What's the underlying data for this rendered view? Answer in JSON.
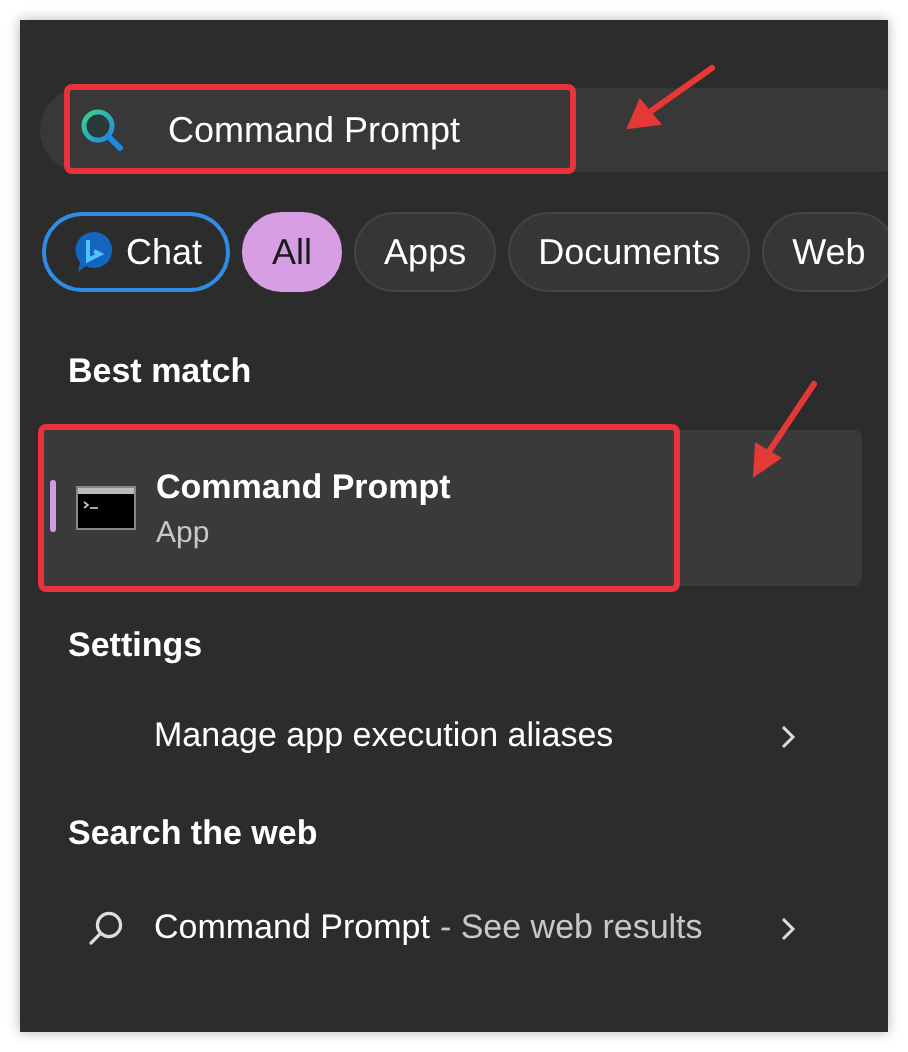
{
  "search": {
    "value": "Command Prompt"
  },
  "filters": [
    {
      "kind": "chat",
      "label": "Chat",
      "selected": false
    },
    {
      "kind": "filter",
      "label": "All",
      "selected": true
    },
    {
      "kind": "filter",
      "label": "Apps",
      "selected": false
    },
    {
      "kind": "filter",
      "label": "Documents",
      "selected": false
    },
    {
      "kind": "filter",
      "label": "Web",
      "selected": false
    }
  ],
  "best_match": {
    "heading": "Best match",
    "title": "Command Prompt",
    "subtitle": "App",
    "selected": true
  },
  "settings": {
    "heading": "Settings",
    "items": [
      {
        "label": "Manage app execution aliases"
      }
    ]
  },
  "web": {
    "heading": "Search the web",
    "items": [
      {
        "query": "Command Prompt",
        "suffix": "- See web results"
      }
    ]
  }
}
